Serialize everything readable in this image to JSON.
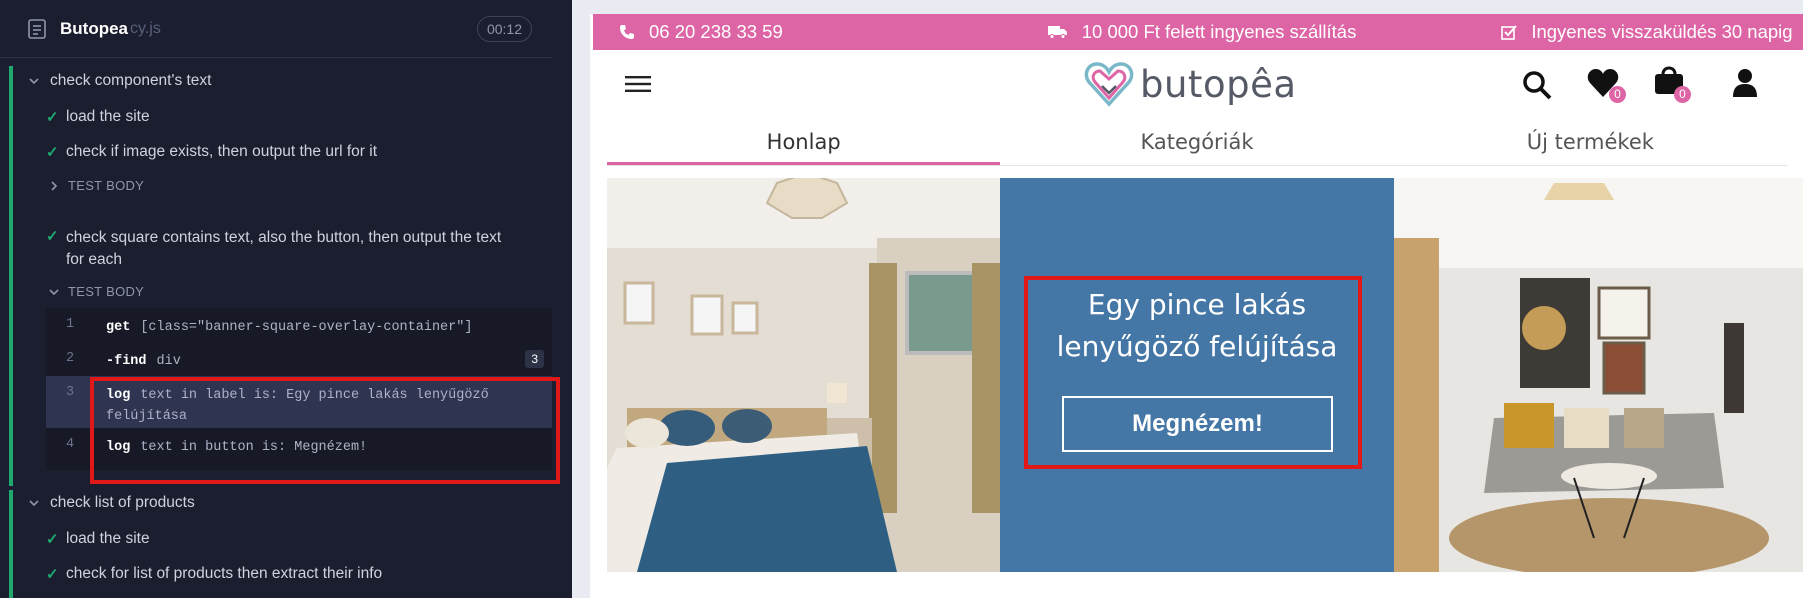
{
  "runner": {
    "spec_name": "Butopea",
    "spec_ext": "cy.js",
    "timer": "00:12",
    "tests": [
      {
        "title": "check component's text"
      },
      {
        "step1": "load the site"
      },
      {
        "step2": "check if image exists, then output the url for it"
      },
      {
        "test_body_1": "TEST BODY"
      },
      {
        "step3_line1": "check square contains text, also the button, then output the text",
        "step3_line2": "for each"
      },
      {
        "test_body_2": "TEST BODY"
      }
    ],
    "commands": [
      {
        "num": "1",
        "key": "get",
        "arg": "[class=\"banner-square-overlay-container\"]"
      },
      {
        "num": "2",
        "key": "-find",
        "arg": "div",
        "badge": "3"
      },
      {
        "num": "3",
        "key": "log",
        "arg_line1": "text in label is: Egy pince lakás lenyűgöző",
        "arg_line2": "felújítása"
      },
      {
        "num": "4",
        "key": "log",
        "arg": "text in button is: Megnézem!"
      }
    ],
    "suite2": {
      "title": "check list of products",
      "step1": "load the site",
      "step2": "check for list of products then extract their info"
    }
  },
  "site": {
    "topbar": {
      "phone": "06 20 238 33 59",
      "shipping": "10 000 Ft felett ingyenes szállítás",
      "returns": "Ingyenes visszaküldés 30 napig",
      "bg_color": "#de65a5"
    },
    "logo_text": "butopêa",
    "wishlist_count": "0",
    "cart_count": "0",
    "tabs": [
      "Honlap",
      "Kategóriák",
      "Új termékek"
    ],
    "banner": {
      "title_line1": "Egy pince lakás",
      "title_line2": "lenyűgöző felújítása",
      "button": "Megnézem!",
      "color": "#4577a6"
    }
  }
}
